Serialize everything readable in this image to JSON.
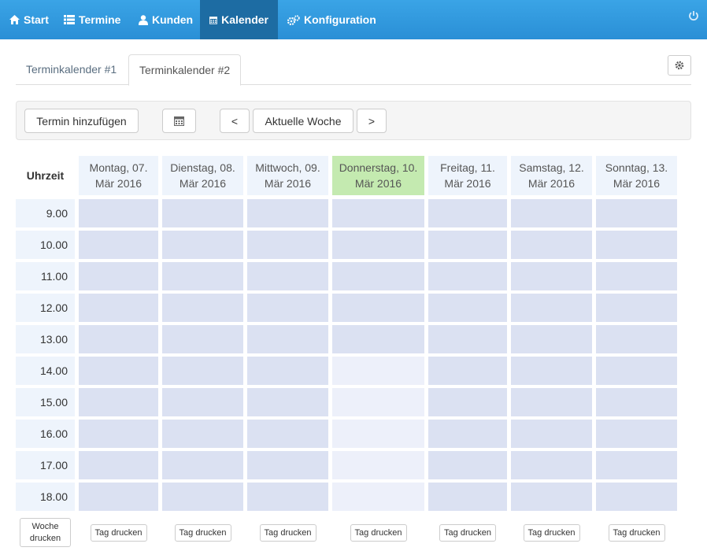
{
  "nav": {
    "items": [
      {
        "label": "Start",
        "icon": "home-icon"
      },
      {
        "label": "Termine",
        "icon": "list-icon"
      },
      {
        "label": "Kunden",
        "icon": "user-icon"
      },
      {
        "label": "Kalender",
        "icon": "calendar-icon"
      },
      {
        "label": "Konfiguration",
        "icon": "cogs-icon"
      }
    ],
    "active": "Kalender"
  },
  "tabs": [
    {
      "label": "Terminkalender #1",
      "active": false
    },
    {
      "label": "Terminkalender #2",
      "active": true
    }
  ],
  "toolbar": {
    "add_label": "Termin hinzufügen",
    "prev_label": "<",
    "current_week_label": "Aktuelle Woche",
    "next_label": ">"
  },
  "calendar": {
    "time_header": "Uhrzeit",
    "days": [
      {
        "line1": "Montag, 07.",
        "line2": "Mär 2016"
      },
      {
        "line1": "Dienstag, 08.",
        "line2": "Mär 2016"
      },
      {
        "line1": "Mittwoch, 09.",
        "line2": "Mär 2016"
      },
      {
        "line1": "Donnerstag, 10.",
        "line2": "Mär 2016"
      },
      {
        "line1": "Freitag, 11.",
        "line2": "Mär 2016"
      },
      {
        "line1": "Samstag, 12.",
        "line2": "Mär 2016"
      },
      {
        "line1": "Sonntag, 13.",
        "line2": "Mär 2016"
      }
    ],
    "today_index": 3,
    "times": [
      "9.00",
      "10.00",
      "11.00",
      "12.00",
      "13.00",
      "14.00",
      "15.00",
      "16.00",
      "17.00",
      "18.00"
    ],
    "colors": {
      "slot": "#dbe1f2",
      "slot_light": "#edf0fa",
      "today": "#c4eab0",
      "header": "#eef4fc"
    }
  },
  "print": {
    "week_line1": "Woche",
    "week_line2": "drucken",
    "day_label": "Tag drucken"
  }
}
